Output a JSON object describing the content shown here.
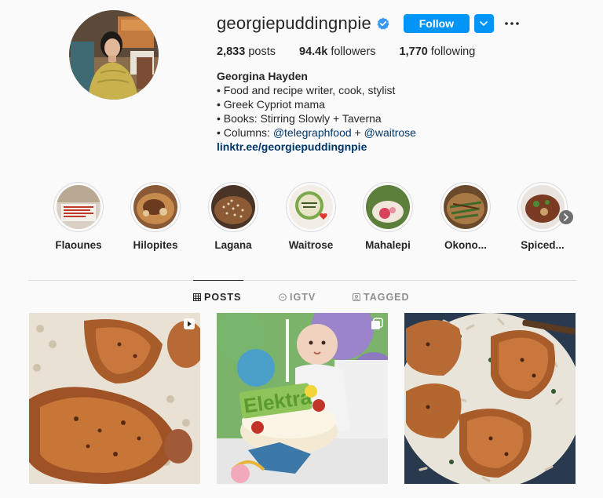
{
  "profile": {
    "username": "georgiepuddingnpie",
    "verified": true,
    "follow_label": "Follow",
    "stats": {
      "posts_count": "2,833",
      "posts_label": "posts",
      "followers_count": "94.4k",
      "followers_label": "followers",
      "following_count": "1,770",
      "following_label": "following"
    },
    "bio": {
      "name": "Georgina Hayden",
      "line1": "• Food and recipe writer, cook, stylist",
      "line2": "• Greek Cypriot mama",
      "line3": "• Books: Stirring Slowly + Taverna",
      "line4_prefix": "• Columns: ",
      "mention1": "@telegraphfood",
      "line4_join": " + ",
      "mention2": "@waitrose",
      "link": "linktr.ee/georgiepuddingnpie"
    }
  },
  "highlights": [
    {
      "label": "Flaounes"
    },
    {
      "label": "Hilopites"
    },
    {
      "label": "Lagana"
    },
    {
      "label": "Waitrose"
    },
    {
      "label": "Mahalepi"
    },
    {
      "label": "Okono..."
    },
    {
      "label": "Spiced..."
    }
  ],
  "tabs": [
    {
      "label": "POSTS",
      "icon": "grid-icon",
      "active": true
    },
    {
      "label": "IGTV",
      "icon": "igtv-icon",
      "active": false
    },
    {
      "label": "TAGGED",
      "icon": "tagged-icon",
      "active": false
    }
  ],
  "posts": [
    {
      "type": "video",
      "icon": "video-icon",
      "subject": "roast chicken on orzo"
    },
    {
      "type": "carousel",
      "icon": "carousel-icon",
      "subject": "baby birthday cake",
      "cake_text": "Elektra"
    },
    {
      "type": "image",
      "icon": "",
      "subject": "roast chicken with pasta"
    }
  ],
  "colors": {
    "accent": "#0095f6",
    "verified": "#3897f0",
    "link": "#00376b",
    "background": "#fafafa",
    "text": "#262626",
    "muted": "#8e8e8e"
  }
}
